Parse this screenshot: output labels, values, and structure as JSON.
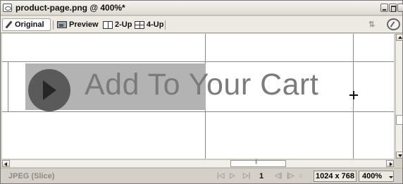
{
  "window": {
    "title": "product-page.png @ 400%*"
  },
  "toolbar": {
    "tabs": [
      {
        "label": "Original",
        "icon": "pencil-icon",
        "active": true
      },
      {
        "label": "Preview",
        "icon": "preview-icon",
        "active": false
      },
      {
        "label": "2-Up",
        "icon": "two-up-icon",
        "active": false
      },
      {
        "label": "4-Up",
        "icon": "four-up-icon",
        "active": false
      }
    ],
    "right_icons": [
      "preview-in-browser-icon",
      "optimize-icon"
    ]
  },
  "canvas": {
    "slice_text": "Add To Your Cart",
    "play_icon": "play-button-icon",
    "cursor_icon": "move-cursor-icon"
  },
  "status": {
    "format": "JPEG (Slice)",
    "frame": "1",
    "dimensions": "1024 x 768",
    "zoom": "400%"
  },
  "colors": {
    "background": "#d4d0c8",
    "slice_bg": "#b3b3b3",
    "slice_text": "#7b7b7b",
    "play_circle": "#5a5a5a"
  }
}
